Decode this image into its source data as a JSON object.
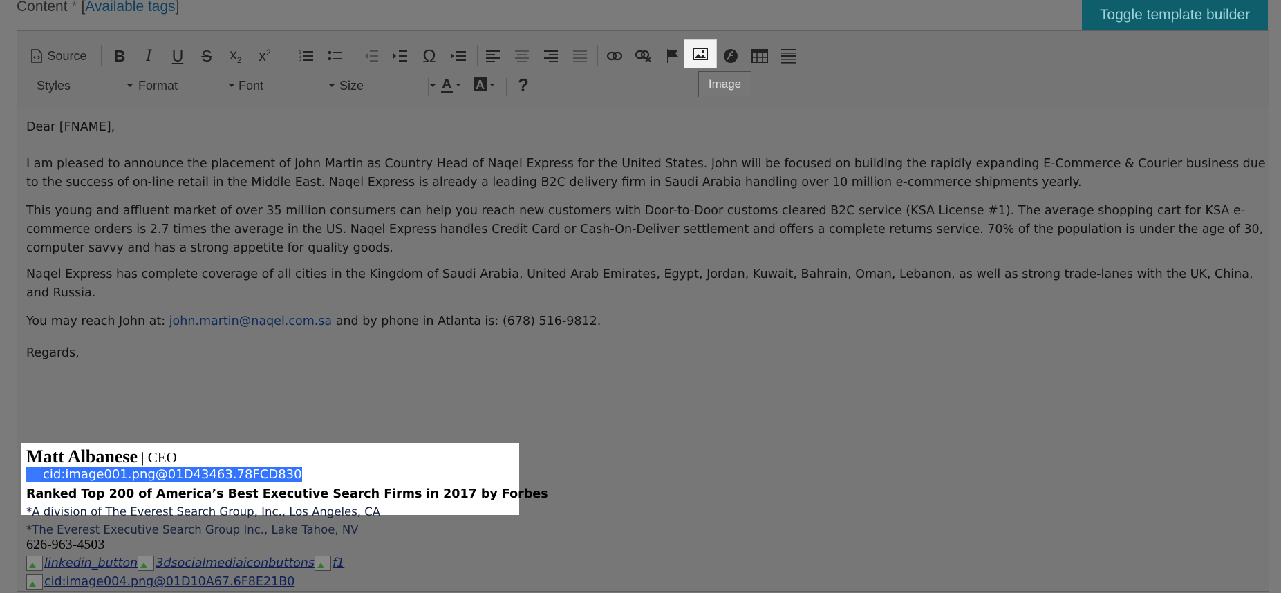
{
  "header": {
    "content_label": "Content",
    "required_mark": "*",
    "tags_open": "[",
    "tags_link": "Available tags",
    "tags_close": "]",
    "toggle_button": "Toggle template builder"
  },
  "toolbar": {
    "source_label": "Source",
    "styles": "Styles",
    "format": "Format",
    "font": "Font",
    "size": "Size",
    "tooltip": "Image",
    "help": "?"
  },
  "email": {
    "greeting": "Dear [FNAME],",
    "para1": "I am pleased to announce the placement of John Martin as Country Head of Naqel Express for the United States. John will be focused on building the rapidly expanding E-Commerce & Courier business due to the success of on-line retail in the Middle East. Naqel Express is already a leading B2C delivery firm in Saudi Arabia handling over 10 million e-commerce shipments yearly.",
    "para2": "This young and affluent market of over 35 million consumers can help you reach new customers with Door-to-Door customs cleared B2C service (KSA License #1). The average shopping cart for KSA e-commerce orders is 2.7 times the average in the US.  Naqel Express handles Credit Card or Cash-On-Deliver settlement and offers a complete returns service. 70% of the population is under the age of 30, computer savvy and has a strong appetite for quality goods.",
    "para3": "Naqel Express has complete coverage of all cities in the Kingdom of Saudi Arabia, United Arab Emirates, Egypt, Jordan, Kuwait, Bahrain, Oman, Lebanon, as well as strong trade-lanes with the UK, China, and Russia.",
    "reach_prefix": "You may reach John at: ",
    "reach_email": "john.martin@naqel.com.sa",
    "reach_suffix": " and by phone in Atlanta is: (678) 516-9812.",
    "regards": "Regards,"
  },
  "signature": {
    "name": "Matt Albanese",
    "title": " | CEO",
    "image1": "cid:image001.png@01D43463.78FCD830",
    "ranked": "Ranked Top 200 of America’s Best Executive Search Firms in 2017 by Forbes",
    "division1": "*A division of The Everest Search Group, Inc., Los Angeles, CA",
    "division2": "*The Everest Executive Search Group Inc., Lake Tahoe, NV",
    "phone": "626-963-4503",
    "img_linkedin": "linkedin_button",
    "img_social": "3dsocialmediaiconbuttons",
    "img_f1": "f1",
    "img_cid4": "cid:image004.png@01D10A67.6F8E21B0"
  }
}
